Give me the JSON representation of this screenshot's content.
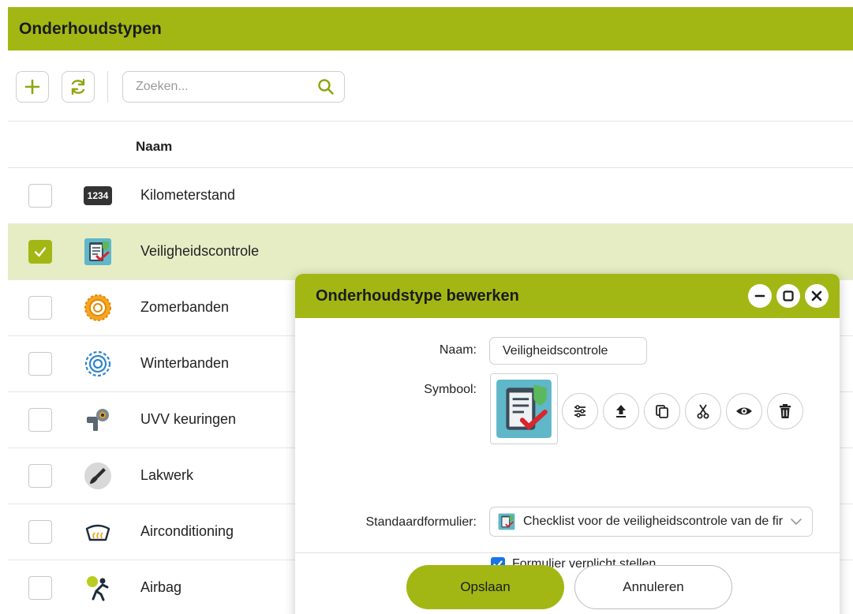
{
  "page": {
    "title": "Onderhoudstypen"
  },
  "toolbar": {
    "add_icon": "plus-icon",
    "refresh_icon": "refresh-icon",
    "search": {
      "placeholder": "Zoeken...",
      "icon": "search-icon"
    }
  },
  "table": {
    "column_name": "Naam",
    "rows": [
      {
        "label": "Kilometerstand",
        "icon": "odometer-icon",
        "selected": false
      },
      {
        "label": "Veiligheidscontrole",
        "icon": "checklist-icon",
        "selected": true
      },
      {
        "label": "Zomerbanden",
        "icon": "summer-tire-icon",
        "selected": false
      },
      {
        "label": "Winterbanden",
        "icon": "winter-tire-icon",
        "selected": false
      },
      {
        "label": "UVV keuringen",
        "icon": "inspection-icon",
        "selected": false
      },
      {
        "label": "Lakwerk",
        "icon": "paint-brush-icon",
        "selected": false
      },
      {
        "label": "Airconditioning",
        "icon": "airconditioning-icon",
        "selected": false
      },
      {
        "label": "Airbag",
        "icon": "airbag-icon",
        "selected": false
      }
    ],
    "odometer_text": "1234"
  },
  "dialog": {
    "title": "Onderhoudstype bewerken",
    "name_label": "Naam:",
    "name_value": "Veiligheidscontrole",
    "symbol_label": "Symbool:",
    "symbol_actions": [
      "settings-icon",
      "upload-icon",
      "copy-icon",
      "cut-icon",
      "eye-icon",
      "trash-icon"
    ],
    "form_label": "Standaardformulier:",
    "form_value": "Checklist voor de veiligheidscontrole van de fir",
    "checkbox_label": "Formulier verplicht stellen",
    "checkbox_checked": true,
    "save_label": "Opslaan",
    "cancel_label": "Annuleren"
  },
  "colors": {
    "accent": "#a2b713",
    "selected_row": "#e6edc4",
    "checkbox_blue": "#1a73e8"
  }
}
